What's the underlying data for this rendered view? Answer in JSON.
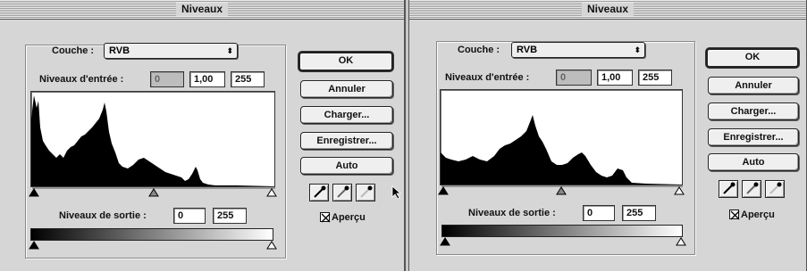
{
  "dialogs": [
    {
      "title": "Niveaux",
      "channel_label": "Couche :",
      "channel_value": "RVB",
      "input_label": "Niveaux d'entrée :",
      "input_black": "0",
      "input_gamma": "1,00",
      "input_white": "255",
      "output_label": "Niveaux de sortie :",
      "output_black": "0",
      "output_white": "255",
      "buttons": {
        "ok": "OK",
        "cancel": "Annuler",
        "load": "Charger...",
        "save": "Enregistrer...",
        "auto": "Auto"
      },
      "preview_label": "Aperçu",
      "preview_checked": true,
      "eyedroppers": [
        "black-eyedropper-icon",
        "gray-eyedropper-icon",
        "white-eyedropper-icon"
      ]
    },
    {
      "title": "Niveaux",
      "channel_label": "Couche :",
      "channel_value": "RVB",
      "input_label": "Niveaux d'entrée :",
      "input_black": "0",
      "input_gamma": "1,00",
      "input_white": "255",
      "output_label": "Niveaux de sortie :",
      "output_black": "0",
      "output_white": "255",
      "buttons": {
        "ok": "OK",
        "cancel": "Annuler",
        "load": "Charger...",
        "save": "Enregistrer...",
        "auto": "Auto"
      },
      "preview_label": "Aperçu",
      "preview_checked": true,
      "eyedroppers": [
        "black-eyedropper-icon",
        "gray-eyedropper-icon",
        "white-eyedropper-icon"
      ]
    }
  ],
  "colors": {
    "dialog_bg": "#d6d6d6",
    "histogram_fill": "#000000"
  }
}
